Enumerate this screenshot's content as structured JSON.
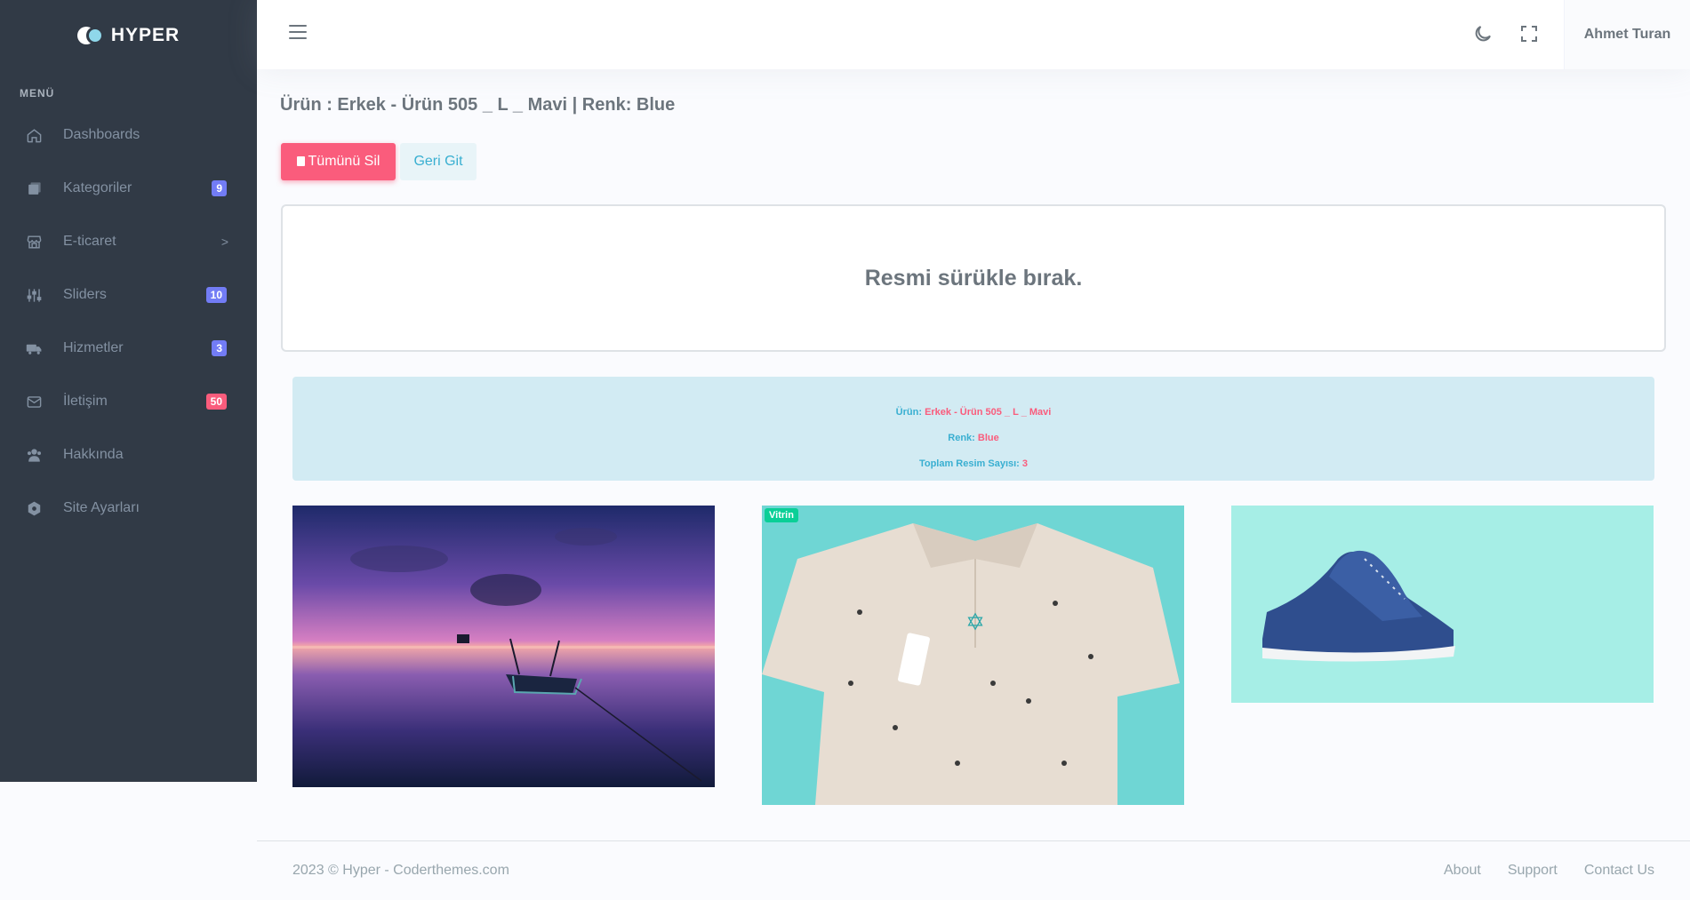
{
  "brand": {
    "name": "HYPER"
  },
  "sidebar": {
    "menu_title": "MENÜ",
    "items": [
      {
        "label": "Dashboards",
        "icon": "home-icon"
      },
      {
        "label": "Kategoriler",
        "icon": "copy-icon",
        "badge": "9",
        "badge_color": "#727cf5"
      },
      {
        "label": "E-ticaret",
        "icon": "store-icon",
        "chevron": ">"
      },
      {
        "label": "Sliders",
        "icon": "sliders-icon",
        "badge": "10",
        "badge_color": "#727cf5"
      },
      {
        "label": "Hizmetler",
        "icon": "truck-icon",
        "badge": "3",
        "badge_color": "#727cf5"
      },
      {
        "label": "İletişim",
        "icon": "mail-icon",
        "badge": "50",
        "badge_color": "#fa5c7c"
      },
      {
        "label": "Hakkında",
        "icon": "users-icon"
      },
      {
        "label": "Site Ayarları",
        "icon": "settings-icon"
      }
    ]
  },
  "topbar": {
    "user_name": "Ahmet Turan"
  },
  "main": {
    "page_title": "Ürün : Erkek - Ürün 505 _ L _ Mavi | Renk: Blue",
    "delete_all_label": "Tümünü Sil",
    "go_back_label": "Geri Git",
    "dropzone_text": "Resmi sürükle bırak.",
    "info": {
      "product_label": "Ürün:",
      "product_value": "Erkek - Ürün 505 _ L _ Mavi",
      "color_label": "Renk:",
      "color_value": "Blue",
      "count_label": "Toplam Resim Sayısı:",
      "count_value": "3"
    },
    "images": [
      {
        "description": "boat-sunset-image"
      },
      {
        "description": "polo-shirt-image",
        "tag": "Vitrin"
      },
      {
        "description": "blue-sneaker-image"
      }
    ]
  },
  "footer": {
    "copyright": "2023 © Hyper - Coderthemes.com",
    "links": [
      "About",
      "Support",
      "Contact Us"
    ]
  },
  "colors": {
    "sidebar_bg": "#313a46",
    "danger": "#fa5c7c",
    "info": "#39afd1",
    "primary": "#727cf5",
    "success": "#0acf97"
  }
}
